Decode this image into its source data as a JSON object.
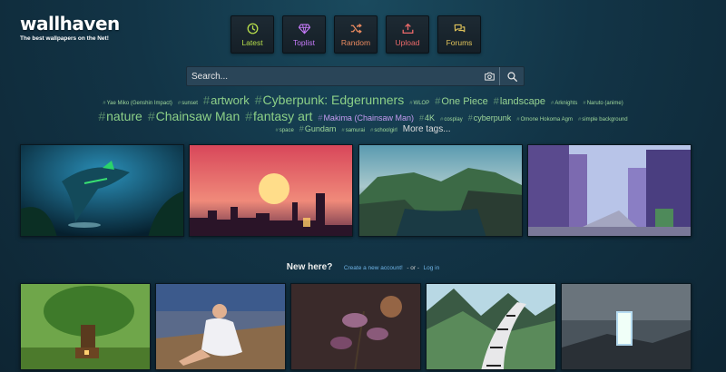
{
  "logo": {
    "title": "wallhaven",
    "tagline": "The best wallpapers on the Net!"
  },
  "nav": [
    {
      "label": "Latest",
      "icon": "clock-icon",
      "color": "#b6dd4b"
    },
    {
      "label": "Toplist",
      "icon": "diamond-icon",
      "color": "#c57af8"
    },
    {
      "label": "Random",
      "icon": "shuffle-icon",
      "color": "#ec8b60"
    },
    {
      "label": "Upload",
      "icon": "upload-icon",
      "color": "#ec6a6a"
    },
    {
      "label": "Forums",
      "icon": "chat-icon",
      "color": "#e3c55b"
    }
  ],
  "search": {
    "placeholder": "Search...",
    "camera_icon": "camera-icon",
    "search_icon": "search-icon"
  },
  "tags": {
    "row1": [
      "Yae Miko (Genshin Impact)",
      "sunset",
      "artwork",
      "Cyberpunk: Edgerunners",
      "WLOP",
      "One Piece",
      "landscape",
      "Arknights",
      "Naruto (anime)"
    ],
    "row2": [
      "nature",
      "Chainsaw Man",
      "fantasy art",
      "Makima (Chainsaw Man)",
      "4K",
      "cosplay",
      "cyberpunk",
      "Omone Hokoma Agm",
      "simple background"
    ],
    "row3": [
      "space",
      "Gundam",
      "samurai",
      "schoolgirl"
    ],
    "more": "More tags..."
  },
  "new_here": {
    "title": "New here?",
    "create_link": "Create a new account!",
    "or": "- or -",
    "login_link": "Log in"
  },
  "thumbnails_top": [
    {
      "subject": "underwater shark scene"
    },
    {
      "subject": "sunset city skyline"
    },
    {
      "subject": "sea cliffs landscape"
    },
    {
      "subject": "anime city street"
    }
  ],
  "thumbnails_bottom": [
    {
      "subject": "fantasy tree house"
    },
    {
      "subject": "woman sitting on bridge"
    },
    {
      "subject": "flowers macro"
    },
    {
      "subject": "keyboard road mountains"
    },
    {
      "subject": "glowing portal landscape"
    }
  ]
}
